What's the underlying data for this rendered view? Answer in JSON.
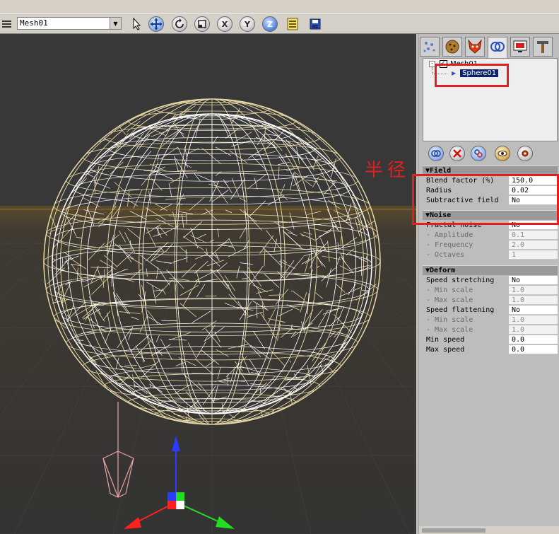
{
  "toolbar": {
    "mesh_select_value": "Mesh01",
    "axis_x": "X",
    "axis_y": "Y",
    "axis_z": "Z",
    "icons": [
      "menu-icon",
      "pointer-icon",
      "move-icon",
      "rotate-icon",
      "scale-icon",
      "x-axis-icon",
      "y-axis-icon",
      "z-axis-icon",
      "list-icon",
      "save-icon"
    ]
  },
  "panel": {
    "tabs": [
      "particles-tab",
      "texture-tab",
      "character-tab",
      "metaball-tab",
      "render-tab",
      "tools-tab"
    ],
    "tree": {
      "root": "Mesh01",
      "child": "Sphere01"
    },
    "field_section": {
      "title": "Field",
      "rows": [
        {
          "name": "Blend factor (%)",
          "value": "150.0"
        },
        {
          "name": "Radius",
          "value": "0.02"
        },
        {
          "name": "Subtractive field",
          "value": "No"
        }
      ]
    },
    "noise_section": {
      "title": "Noise",
      "rows": [
        {
          "name": "Fractal noise",
          "value": "No"
        },
        {
          "name": "- Amplitude",
          "value": "0.1"
        },
        {
          "name": "- Frequency",
          "value": "2.0"
        },
        {
          "name": "- Octaves",
          "value": "1"
        }
      ]
    },
    "deform_section": {
      "title": "Deform",
      "rows": [
        {
          "name": "Speed stretching",
          "value": "No"
        },
        {
          "name": "- Min scale",
          "value": "1.0"
        },
        {
          "name": "- Max scale",
          "value": "1.0"
        },
        {
          "name": "Speed flattening",
          "value": "No"
        },
        {
          "name": "- Min scale",
          "value": "1.0"
        },
        {
          "name": "- Max scale",
          "value": "1.0"
        },
        {
          "name": "Min speed",
          "value": "0.0"
        },
        {
          "name": "Max speed",
          "value": "0.0"
        }
      ]
    }
  },
  "annotation": {
    "text": "半径",
    "color": "#e02020"
  },
  "colors": {
    "viewport_bg": "#3a3a3a",
    "wire_outer": "#e6d7a6",
    "wire_inner": "#ffffff",
    "selection": "#0a246a"
  }
}
